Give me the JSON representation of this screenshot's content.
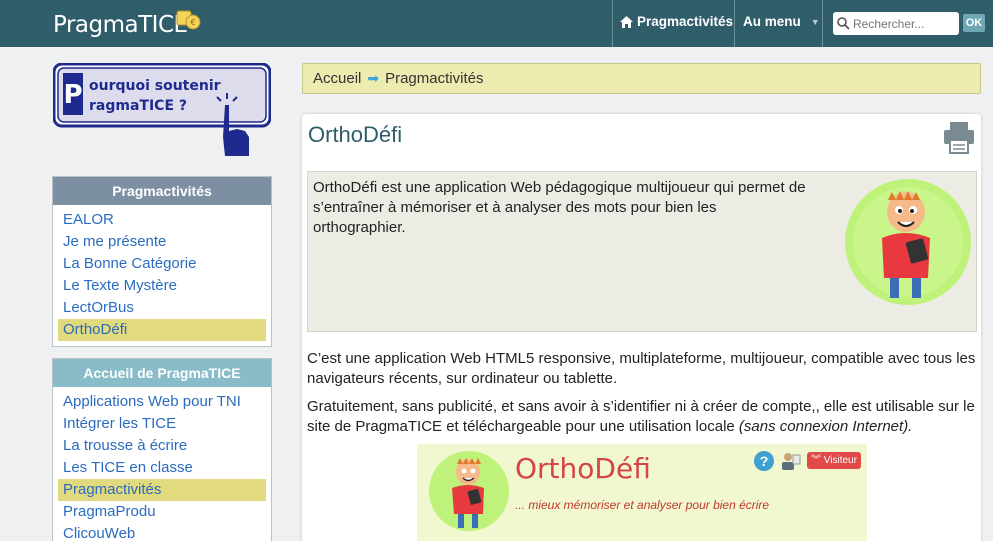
{
  "header": {
    "logo": "PragmaTICE",
    "nav": [
      {
        "label": "Pragmactivités",
        "icon": "home-icon"
      },
      {
        "label": "Au menu",
        "icon": "chevron-down-icon"
      }
    ],
    "search": {
      "placeholder": "Rechercher...",
      "ok_label": "OK"
    }
  },
  "sidebar": {
    "promo": {
      "line1": "ourquoi soutenir",
      "line2": "ragmaTICE ?",
      "initial": "P"
    },
    "panel1": {
      "title": "Pragmactivités",
      "items": [
        "EALOR",
        "Je me présente",
        "La Bonne Catégorie",
        "Le Texte Mystère",
        "LectOrBus",
        "OrthoDéfi"
      ],
      "active_index": 5,
      "header_color": "#7d8fa3"
    },
    "panel2": {
      "title": "Accueil de PragmaTICE",
      "items": [
        "Applications Web pour TNI",
        "Intégrer les TICE",
        "La trousse à écrire",
        "Les TICE en classe",
        "Pragmactivités",
        "PragmaProdu",
        "ClicouWeb"
      ],
      "active_index": 4,
      "header_color": "#88bcc9"
    }
  },
  "breadcrumb": {
    "home": "Accueil",
    "current": "Pragmactivités"
  },
  "main": {
    "title": "OrthoDéfi",
    "intro": "OrthoDéfi est une application Web pédagogique multijoueur qui permet de s’entraîner à mémoriser et à analyser des mots pour bien les orthographier.",
    "para1": "C’est une application Web HTML5 responsive, multiplateforme, multijoueur, compatible avec tous les navigateurs récents, sur ordinateur ou tablette.",
    "para2_main": "Gratuitement, sans publicité, et sans avoir à s’identifier ni à créer de compte,, elle est utilisable sur le site de PragmaTICE et téléchargeable pour une utilisation locale ",
    "para2_italic": "(sans connexion Internet).",
    "banner": {
      "title": "OrthoDéfi",
      "subtitle": "... mieux mémoriser et analyser pour bien écrire",
      "help": "?",
      "visitor": "Visiteur"
    }
  },
  "colors": {
    "topbar": "#2f5d6a",
    "link": "#2b6bbf",
    "active_item": "#e2da7f",
    "breadcrumb_bg": "#ecebb0",
    "title": "#2f5d6a",
    "banner_title": "#d64545"
  }
}
